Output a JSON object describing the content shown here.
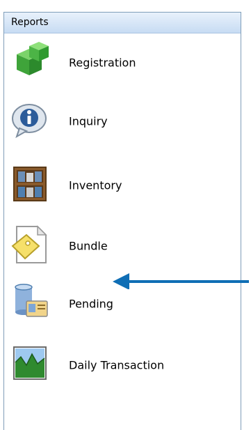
{
  "panel": {
    "title": "Reports",
    "items": [
      {
        "label": "Registration",
        "icon": "green-cubes-icon"
      },
      {
        "label": "Inquiry",
        "icon": "info-icon"
      },
      {
        "label": "Inventory",
        "icon": "bookshelf-icon"
      },
      {
        "label": "Bundle",
        "icon": "document-tag-icon"
      },
      {
        "label": "Pending",
        "icon": "database-card-icon"
      },
      {
        "label": "Daily Transaction",
        "icon": "chart-icon"
      }
    ]
  },
  "colors": {
    "arrow": "#0f6eb5",
    "border": "#7f9db9"
  }
}
